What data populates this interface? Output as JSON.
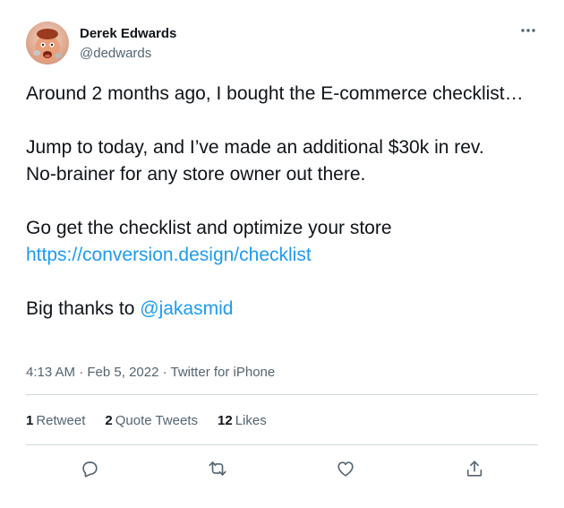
{
  "author": {
    "display_name": "Derek Edwards",
    "handle": "@dedwards",
    "avatar_icon": "profile-photo"
  },
  "more_icon": "more-horizontal-icon",
  "tweet": {
    "line1": "Around 2 months ago, I bought the E-commerce checklist…",
    "line2a": "Jump to today, and I’ve made an additional $30k in rev.",
    "line2b": "No-brainer for any store owner out there.",
    "line3": "Go get the checklist and optimize your store",
    "link": "https://conversion.design/checklist",
    "thanks_prefix": "Big thanks to ",
    "mention": "@jakasmid"
  },
  "meta": {
    "time": "4:13 AM",
    "date": "Feb 5, 2022",
    "source": "Twitter for iPhone",
    "separator": " · "
  },
  "stats": {
    "retweets_count": "1",
    "retweets_label": "Retweet",
    "quotes_count": "2",
    "quotes_label": "Quote Tweets",
    "likes_count": "12",
    "likes_label": "Likes"
  },
  "actions": {
    "reply_icon": "reply-icon",
    "retweet_icon": "retweet-icon",
    "like_icon": "heart-icon",
    "share_icon": "share-icon"
  },
  "colors": {
    "text": "#0f1419",
    "secondary": "#536471",
    "link": "#1d9bf0",
    "divider": "#cfd9de"
  }
}
